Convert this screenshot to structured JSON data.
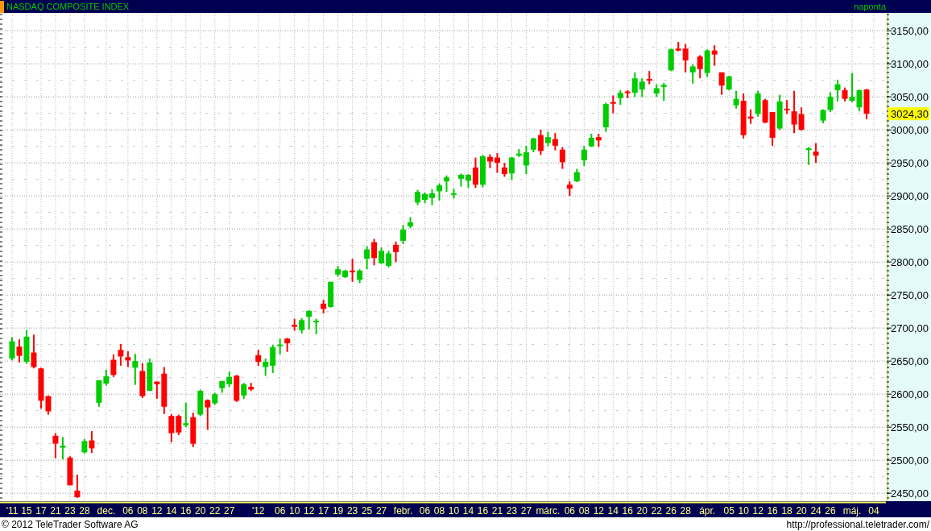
{
  "header": {
    "title": "NASDAQ COMPOSITE INDEX",
    "interval": "naponta"
  },
  "chart": {
    "chart_data": {
      "type": "candlestick",
      "categories": [
        "'11",
        null,
        "15",
        null,
        "17",
        null,
        "21",
        null,
        "23",
        null,
        "28",
        null,
        null,
        "dec.",
        null,
        null,
        "06",
        null,
        "08",
        null,
        "12",
        null,
        "14",
        null,
        "16",
        null,
        "20",
        null,
        "22",
        null,
        "27",
        null,
        null,
        null,
        "'12",
        null,
        null,
        "06",
        null,
        "10",
        null,
        "12",
        null,
        "17",
        null,
        "19",
        null,
        "23",
        null,
        "25",
        null,
        "27",
        null,
        null,
        "febr.",
        null,
        null,
        "06",
        null,
        "08",
        null,
        "10",
        null,
        "14",
        null,
        "16",
        null,
        "21",
        null,
        "23",
        null,
        "27",
        null,
        null,
        "márc.",
        null,
        null,
        "06",
        null,
        "08",
        null,
        "12",
        null,
        "14",
        null,
        "16",
        null,
        "20",
        null,
        "22",
        null,
        "26",
        null,
        "28",
        null,
        null,
        "ápr.",
        null,
        null,
        "05",
        null,
        "10",
        null,
        "12",
        null,
        "16",
        null,
        "18",
        null,
        "20",
        null,
        "24",
        null,
        "26",
        null,
        null,
        "máj.",
        null,
        null,
        "04"
      ],
      "ohlc": [
        [
          2654,
          2686,
          2651,
          2680
        ],
        [
          2672,
          2683,
          2648,
          2658
        ],
        [
          2649,
          2697,
          2646,
          2687
        ],
        [
          2663,
          2690,
          2639,
          2641
        ],
        [
          2639,
          2640,
          2578,
          2590
        ],
        [
          2597,
          2598,
          2569,
          2574
        ],
        [
          2537,
          2541,
          2503,
          2525
        ],
        [
          2519,
          2535,
          2501,
          2522
        ],
        [
          2504,
          2506,
          2462,
          2462
        ],
        [
          2454,
          2478,
          2443,
          2444
        ],
        [
          2512,
          2532,
          2510,
          2529
        ],
        [
          2530,
          2544,
          2511,
          2518
        ],
        [
          2587,
          2621,
          2581,
          2621
        ],
        [
          2616,
          2637,
          2613,
          2627
        ],
        [
          2652,
          2660,
          2626,
          2629
        ],
        [
          2667,
          2676,
          2643,
          2657
        ],
        [
          2656,
          2665,
          2641,
          2651
        ],
        [
          2640,
          2661,
          2614,
          2650
        ],
        [
          2635,
          2647,
          2594,
          2597
        ],
        [
          2605,
          2654,
          2605,
          2648
        ],
        [
          2619,
          2619,
          2593,
          2615
        ],
        [
          2631,
          2641,
          2570,
          2581
        ],
        [
          2567,
          2570,
          2527,
          2541
        ],
        [
          2567,
          2569,
          2538,
          2542
        ],
        [
          2553,
          2587,
          2550,
          2556
        ],
        [
          2565,
          2572,
          2520,
          2525
        ],
        [
          2569,
          2607,
          2567,
          2605
        ],
        [
          2591,
          2592,
          2546,
          2580
        ],
        [
          2586,
          2602,
          2584,
          2600
        ],
        [
          2609,
          2620,
          2602,
          2620
        ],
        [
          2615,
          2634,
          2611,
          2626
        ],
        [
          2628,
          2629,
          2588,
          2590
        ],
        [
          2598,
          2617,
          2593,
          2615
        ],
        [
          2611,
          2617,
          2605,
          2607
        ],
        [
          2659,
          2667,
          2643,
          2649
        ],
        [
          2641,
          2654,
          2628,
          2649
        ],
        [
          2643,
          2675,
          2632,
          2671
        ],
        [
          2673,
          2684,
          2660,
          2675
        ],
        [
          2684,
          2685,
          2664,
          2677
        ],
        [
          2705,
          2714,
          2696,
          2702
        ],
        [
          2697,
          2715,
          2692,
          2712
        ],
        [
          2717,
          2727,
          2698,
          2726
        ],
        [
          2709,
          2714,
          2691,
          2711
        ],
        [
          2737,
          2743,
          2722,
          2729
        ],
        [
          2732,
          2770,
          2731,
          2770
        ],
        [
          2781,
          2794,
          2778,
          2789
        ],
        [
          2777,
          2788,
          2776,
          2787
        ],
        [
          2787,
          2805,
          2770,
          2785
        ],
        [
          2773,
          2789,
          2768,
          2787
        ],
        [
          2805,
          2824,
          2789,
          2819
        ],
        [
          2830,
          2835,
          2795,
          2806
        ],
        [
          2798,
          2822,
          2797,
          2817
        ],
        [
          2794,
          2817,
          2792,
          2813
        ],
        [
          2826,
          2831,
          2800,
          2815
        ],
        [
          2832,
          2856,
          2827,
          2849
        ],
        [
          2854,
          2868,
          2851,
          2860
        ],
        [
          2890,
          2909,
          2886,
          2906
        ],
        [
          2894,
          2905,
          2889,
          2903
        ],
        [
          2897,
          2910,
          2886,
          2904
        ],
        [
          2907,
          2919,
          2893,
          2916
        ],
        [
          2922,
          2931,
          2906,
          2928
        ],
        [
          2902,
          2911,
          2896,
          2904
        ],
        [
          2926,
          2934,
          2914,
          2932
        ],
        [
          2923,
          2933,
          2912,
          2932
        ],
        [
          2943,
          2958,
          2912,
          2917
        ],
        [
          2917,
          2962,
          2913,
          2960
        ],
        [
          2959,
          2963,
          2942,
          2952
        ],
        [
          2958,
          2965,
          2935,
          2950
        ],
        [
          2943,
          2950,
          2929,
          2933
        ],
        [
          2934,
          2959,
          2924,
          2958
        ],
        [
          2961,
          2971,
          2959,
          2964
        ],
        [
          2946,
          2976,
          2933,
          2966
        ],
        [
          2970,
          2988,
          2966,
          2987
        ],
        [
          2992,
          3000,
          2962,
          2968
        ],
        [
          2980,
          2997,
          2975,
          2989
        ],
        [
          2986,
          2995,
          2969,
          2976
        ],
        [
          2970,
          2974,
          2941,
          2951
        ],
        [
          2917,
          2922,
          2900,
          2911
        ],
        [
          2922,
          2941,
          2921,
          2936
        ],
        [
          2954,
          2976,
          2945,
          2970
        ],
        [
          2975,
          2994,
          2974,
          2988
        ],
        [
          2989,
          2994,
          2974,
          2984
        ],
        [
          3004,
          3041,
          2997,
          3039
        ],
        [
          3042,
          3052,
          3025,
          3040
        ],
        [
          3048,
          3060,
          3038,
          3056
        ],
        [
          3058,
          3060,
          3048,
          3056
        ],
        [
          3056,
          3087,
          3050,
          3078
        ],
        [
          3061,
          3078,
          3050,
          3073
        ],
        [
          3077,
          3089,
          3069,
          3075
        ],
        [
          3055,
          3069,
          3050,
          3063
        ],
        [
          3065,
          3071,
          3044,
          3068
        ],
        [
          3090,
          3123,
          3089,
          3122
        ],
        [
          3123,
          3133,
          3119,
          3120
        ],
        [
          3123,
          3130,
          3087,
          3105
        ],
        [
          3087,
          3099,
          3070,
          3096
        ],
        [
          3111,
          3113,
          3078,
          3092
        ],
        [
          3086,
          3122,
          3080,
          3120
        ],
        [
          3120,
          3128,
          3097,
          3114
        ],
        [
          3087,
          3087,
          3053,
          3067
        ],
        [
          3061,
          3082,
          3060,
          3081
        ],
        [
          3037,
          3059,
          3032,
          3047
        ],
        [
          3044,
          3055,
          2987,
          2992
        ],
        [
          3020,
          3031,
          3009,
          3017
        ],
        [
          3024,
          3059,
          3020,
          3055
        ],
        [
          3045,
          3047,
          3010,
          3011
        ],
        [
          3027,
          3027,
          2976,
          2988
        ],
        [
          3002,
          3053,
          3000,
          3043
        ],
        [
          3032,
          3045,
          3024,
          3030
        ],
        [
          3028,
          3059,
          2995,
          3008
        ],
        [
          3024,
          3034,
          2999,
          3000
        ],
        [
          2970,
          2974,
          2947,
          2972
        ],
        [
          2967,
          2980,
          2950,
          2961
        ],
        [
          3014,
          3031,
          3010,
          3030
        ],
        [
          3030,
          3057,
          3027,
          3050
        ],
        [
          3060,
          3076,
          3043,
          3069
        ],
        [
          3060,
          3064,
          3043,
          3047
        ],
        [
          3044,
          3086,
          3042,
          3050
        ],
        [
          3034,
          3061,
          3028,
          3060
        ],
        [
          3061,
          3062,
          3016,
          3024.3
        ],
        null
      ],
      "ylim": [
        2438,
        3177
      ],
      "yticks": [
        {
          "value": 2450,
          "label": "2450,00"
        },
        {
          "value": 2500,
          "label": "2500,00"
        },
        {
          "value": 2550,
          "label": "2550,00"
        },
        {
          "value": 2600,
          "label": "2600,00"
        },
        {
          "value": 2650,
          "label": "2650,00"
        },
        {
          "value": 2700,
          "label": "2700,00"
        },
        {
          "value": 2750,
          "label": "2750,00"
        },
        {
          "value": 2800,
          "label": "2800,00"
        },
        {
          "value": 2850,
          "label": "2850,00"
        },
        {
          "value": 2900,
          "label": "2900,00"
        },
        {
          "value": 2950,
          "label": "2950,00"
        },
        {
          "value": 3000,
          "label": "3000,00"
        },
        {
          "value": 3050,
          "label": "3050,00"
        },
        {
          "value": 3100,
          "label": "3100,00"
        },
        {
          "value": 3150,
          "label": "3150,00"
        }
      ],
      "grid": true,
      "annotations": [
        "3024,30"
      ]
    }
  },
  "footer": {
    "copyright": "© 2012 TeleTrader Software AG",
    "url": "http://professional.teletrader.com/"
  }
}
